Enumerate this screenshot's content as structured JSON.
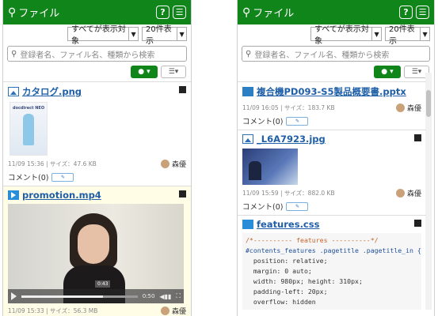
{
  "left": {
    "title": "ファイル",
    "filter": {
      "target": "すべてが表示対象",
      "count": "20件表示"
    },
    "search": {
      "placeholder": "登録者名、ファイル名、種類から検索"
    },
    "items": [
      {
        "name": "カタログ.png",
        "meta": "11/09 15:36 | サイズ：47.6 KB",
        "user": "森優",
        "comment": "コメント(0)",
        "thumb_text": "docdirect NEO"
      },
      {
        "name": "promotion.mp4",
        "meta": "11/09 15:33 | サイズ：56.3 MB",
        "user": "森優",
        "video": {
          "current": "0:50",
          "tip": "0:43",
          "progress": 0.7
        }
      }
    ]
  },
  "right": {
    "title": "ファイル",
    "filter": {
      "target": "すべてが表示対象",
      "count": "20件表示"
    },
    "search": {
      "placeholder": "登録者名、ファイル名、種類から検索"
    },
    "items": [
      {
        "name": "複合機PD093-S5製品概要書.pptx",
        "meta": "11/09 16:05 | サイズ：183.7 KB",
        "user": "森優",
        "comment": "コメント(0)"
      },
      {
        "name": "_L6A7923.jpg",
        "meta": "11/09 15:59 | サイズ：882.0 KB",
        "user": "森優",
        "comment": "コメント(0)"
      },
      {
        "name": "features.css"
      }
    ],
    "code": {
      "line1": "/*---------- features ----------*/",
      "line2": "#contents_features .pagetitle .pagetitle_in {",
      "line3": "  position: relative;",
      "line4": "  margin: 0 auto;",
      "line5": "  width: 980px; height: 310px;",
      "line6": "  padding-left: 20px;",
      "line7": "  overflow: hidden"
    }
  },
  "colors": {
    "accent": "#10851a",
    "link": "#1f5fa8"
  }
}
